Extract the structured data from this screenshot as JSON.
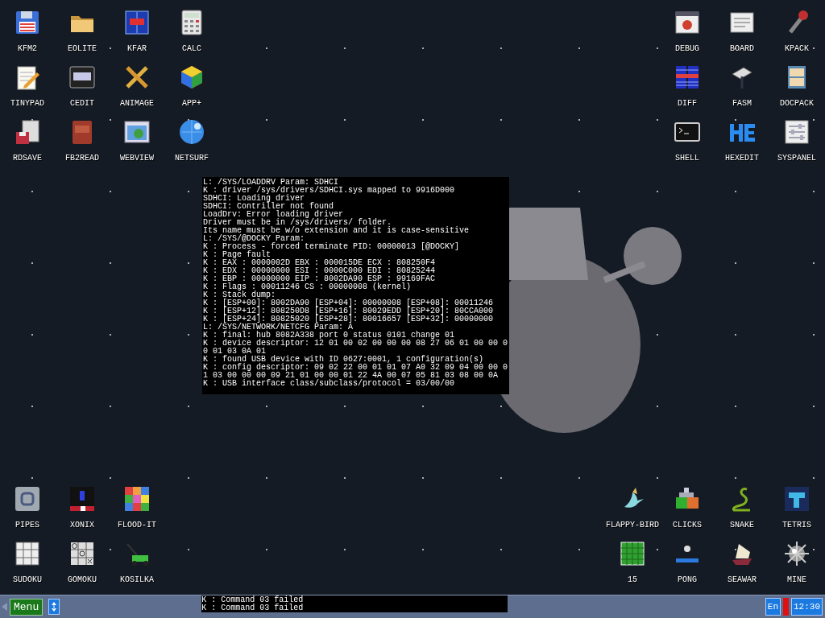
{
  "desktop": {
    "icons_top_left": [
      {
        "label": "KFM2"
      },
      {
        "label": "EOLITE"
      },
      {
        "label": "KFAR"
      },
      {
        "label": "CALC"
      },
      {
        "label": "TINYPAD"
      },
      {
        "label": "CEDIT"
      },
      {
        "label": "ANIMAGE"
      },
      {
        "label": "APP+"
      },
      {
        "label": "RDSAVE"
      },
      {
        "label": "FB2READ"
      },
      {
        "label": "WEBVIEW"
      },
      {
        "label": "NETSURF"
      }
    ],
    "icons_top_right": [
      {
        "label": "DEBUG"
      },
      {
        "label": "BOARD"
      },
      {
        "label": "KPACK"
      },
      {
        "label": "DIFF"
      },
      {
        "label": "FASM"
      },
      {
        "label": "DOCPACK"
      },
      {
        "label": "SHELL"
      },
      {
        "label": "HEXEDIT"
      },
      {
        "label": "SYSPANEL"
      }
    ],
    "icons_bottom_left": [
      {
        "label": "PIPES"
      },
      {
        "label": "XONIX"
      },
      {
        "label": "FLOOD-IT"
      },
      {
        "label": "SUDOKU"
      },
      {
        "label": "GOMOKU"
      },
      {
        "label": "KOSILKA"
      }
    ],
    "icons_bottom_right": [
      {
        "label": "FLAPPY-BIRD"
      },
      {
        "label": "CLICKS"
      },
      {
        "label": "SNAKE"
      },
      {
        "label": "TETRIS"
      },
      {
        "label": "15"
      },
      {
        "label": "PONG"
      },
      {
        "label": "SEAWAR"
      },
      {
        "label": "MINE"
      }
    ]
  },
  "console": {
    "lines": [
      "L: /SYS/LOADDRV Param: SDHCI",
      "K : driver /sys/drivers/SDHCI.sys mapped to 9916D000",
      "SDHCI: Loading driver",
      "SDHCI: Contriller not found",
      "LoadDrv: Error loading driver",
      "Driver must be in /sys/drivers/ folder.",
      "Its name must be w/o extension and it is case-sensitive",
      "L: /SYS/@DOCKY Param:",
      "K : Process - forced terminate PID: 00000013 [@DOCKY]",
      "K : Page fault",
      "K : EAX : 0000002D EBX : 000015DE ECX : 808250F4",
      "K : EDX : 00000000 ESI : 0000C000 EDI : 80825244",
      "K : EBP : 00000000 EIP : 8002DA90 ESP : 99169FAC",
      "K : Flags : 00011246 CS : 00000008 (kernel)",
      "K : Stack dump:",
      "K : [ESP+00]: 8002DA90 [ESP+04]: 00000008 [ESP+08]: 00011246",
      "K : [ESP+12]: 808250D8 [ESP+16]: 80029EDD [ESP+20]: 80CCA000",
      "K : [ESP+24]: 80825020 [ESP+28]: 80016657 [ESP+32]: 00000000",
      "L: /SYS/NETWORK/NETCFG Param: A",
      "K : final: hub 8082A338 port 0 status 0101 change 01",
      "K : device descriptor: 12 01 00 02 00 00 00 08 27 06 01 00 00 0",
      "0 01 03 0A 01",
      "K : found USB device with ID 0627:0001, 1 configuration(s)",
      "K : config descriptor: 09 02 22 00 01 01 07 A0 32 09 04 00 00 0",
      "1 03 00 00 00 09 21 01 00 00 01 22 4A 00 07 05 81 03 08 00 0A",
      "K : USB interface class/subclass/protocol = 03/00/00"
    ]
  },
  "taskbar": {
    "menu_button": "Menu",
    "log_lines": [
      "K : Command 03 failed",
      "K : Command 03 failed"
    ],
    "language": "En",
    "clock": "12:30"
  }
}
